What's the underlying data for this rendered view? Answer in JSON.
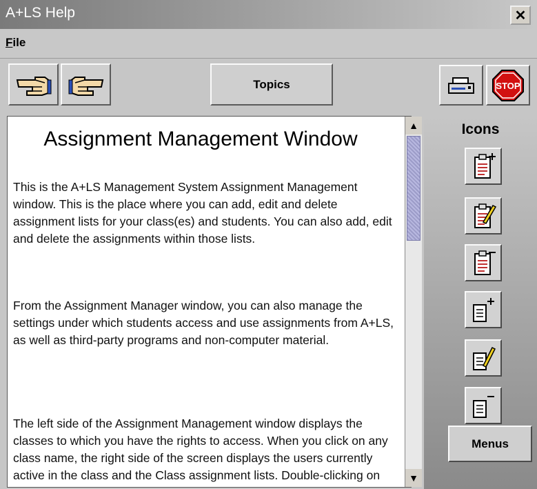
{
  "window": {
    "title": "A+LS Help",
    "close_label": "✕"
  },
  "menubar": {
    "file_underlined": "F",
    "file_rest": "ile"
  },
  "toolbar": {
    "back_icon": "pointing-hand-left-icon",
    "forward_icon": "pointing-hand-right-icon",
    "topics_label": "Topics",
    "print_icon": "printer-icon",
    "stop_label": "STOP"
  },
  "content": {
    "heading": "Assignment Management Window",
    "paragraphs": [
      "This is the A+LS Management System Assignment Management window.  This is the place where you can add, edit and delete assignment lists for your class(es) and students.  You can also add, edit and delete the assignments within those lists.",
      "From the Assignment Manager window, you can also manage the settings under which students access and use assignments from A+LS, as well as third-party programs and non-computer material.",
      "The left side of the Assignment Management window displays the classes to which you have the rights to access.  When you click on any class name, the right side of the screen displays the users currently active in the class and the Class assignment lists.  Double-clicking on any class name"
    ]
  },
  "side": {
    "icons_label": "Icons",
    "icons": [
      "add-assignment-list-icon",
      "edit-assignment-list-icon",
      "delete-assignment-list-icon",
      "add-assignment-icon",
      "edit-assignment-icon",
      "delete-assignment-icon"
    ],
    "menus_label": "Menus"
  }
}
